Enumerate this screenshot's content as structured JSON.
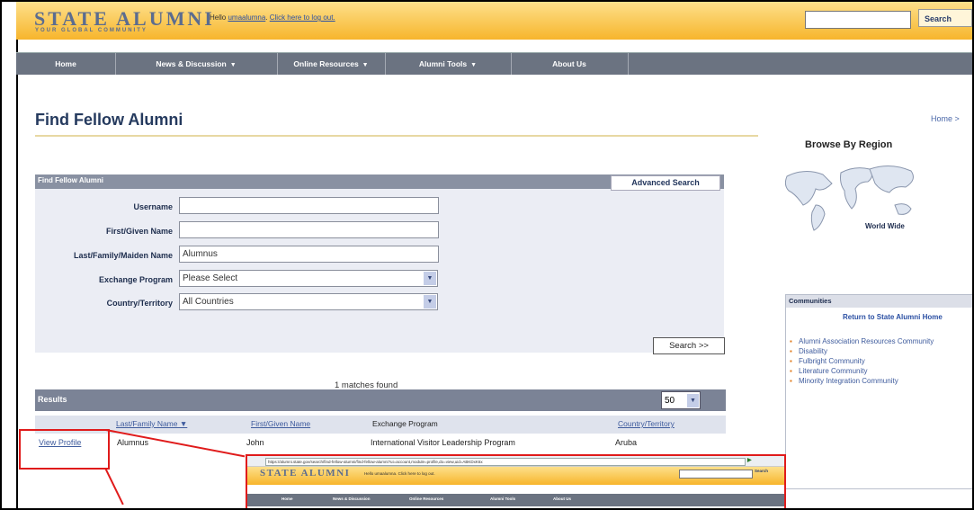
{
  "header": {
    "logo": "STATE ALUMNI",
    "logo_sub": "YOUR GLOBAL COMMUNITY",
    "hello_text": "Hello",
    "hello_user": "umaalumna",
    "hello_link": "Click here to log out.",
    "search_button": "Search"
  },
  "nav": {
    "items": [
      {
        "label": "Home"
      },
      {
        "label": "News & Discussion"
      },
      {
        "label": "Online Resources"
      },
      {
        "label": "Alumni Tools"
      },
      {
        "label": "About Us"
      }
    ]
  },
  "page": {
    "title": "Find Fellow Alumni",
    "breadcrumb": "Home >"
  },
  "form": {
    "panel_title": "Find Fellow Alumni",
    "advanced_search": "Advanced Search",
    "username_label": "Username",
    "username_value": "",
    "first_name_label": "First/Given Name",
    "first_name_value": "",
    "last_name_label": "Last/Family/Maiden Name",
    "last_name_value": "Alumnus",
    "exchange_label": "Exchange Program",
    "exchange_value": "Please Select",
    "country_label": "Country/Territory",
    "country_value": "All Countries",
    "search_button": "Search >>"
  },
  "results": {
    "matches": "1 matches found",
    "label": "Results",
    "per_page": "50",
    "columns": {
      "last": "Last/Family Name",
      "first": "First/Given Name",
      "program": "Exchange Program",
      "country": "Country/Territory"
    },
    "rows": [
      {
        "action": "View Profile",
        "last": "Alumnus",
        "first": "John",
        "program": "International Visitor Leadership Program",
        "country": "Aruba"
      }
    ]
  },
  "sidebar": {
    "browse_title": "Browse By Region",
    "map_label": "World Wide",
    "communities_title": "Communities",
    "return_link": "Return to State Alumni Home",
    "items": [
      {
        "label": "Alumni Association Resources Community"
      },
      {
        "label": "Disability"
      },
      {
        "label": "Fulbright Community"
      },
      {
        "label": "Literature Community"
      },
      {
        "label": "Minority Integration Community"
      }
    ]
  },
  "inset": {
    "address": "https://alumni.state.gov/search/find-fellow-alumni/find-fellow-alumni?ui=account,module=profile,do=view,uid=ABKDxK6x",
    "logo": "STATE ALUMNI",
    "search": "Search",
    "nav": [
      "Home",
      "News & Discussion",
      "Online Resources",
      "Alumni Tools",
      "About Us"
    ]
  },
  "colors": {
    "header_gold": "#f7b52c",
    "nav_gray": "#6b7381",
    "title_navy": "#253a5e",
    "link_blue": "#3e5b9d",
    "callout_red": "#e01b1b"
  }
}
